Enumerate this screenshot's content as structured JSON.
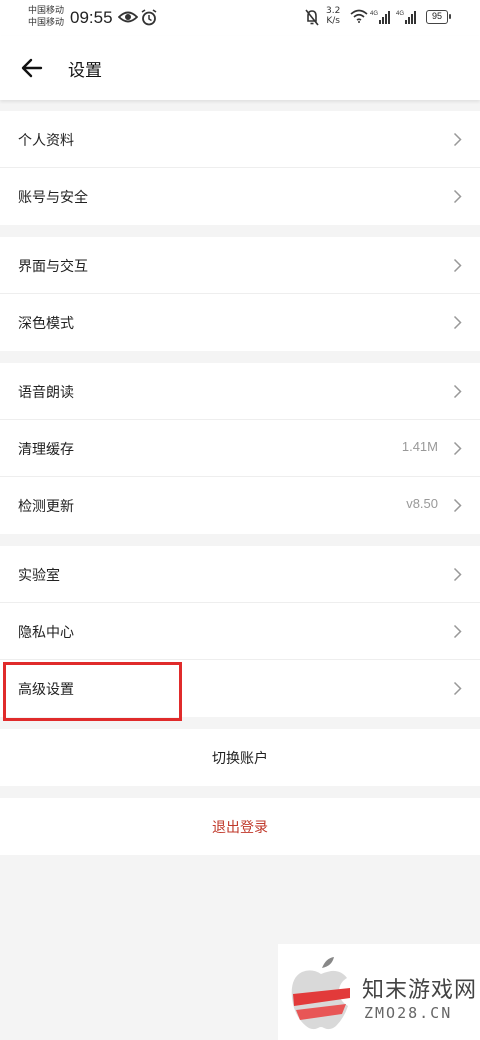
{
  "status_bar": {
    "carrier_1": "中国移动",
    "carrier_2": "中国移动",
    "time": "09:55",
    "speed_value": "3.2",
    "speed_unit": "K/s",
    "battery": "95"
  },
  "header": {
    "title": "设置"
  },
  "groups": [
    {
      "items": [
        {
          "label": "个人资料"
        },
        {
          "label": "账号与安全"
        }
      ]
    },
    {
      "items": [
        {
          "label": "界面与交互"
        },
        {
          "label": "深色模式"
        }
      ]
    },
    {
      "items": [
        {
          "label": "语音朗读"
        },
        {
          "label": "清理缓存",
          "value": "1.41M"
        },
        {
          "label": "检测更新",
          "value": "v8.50"
        }
      ]
    },
    {
      "items": [
        {
          "label": "实验室"
        },
        {
          "label": "隐私中心"
        },
        {
          "label": "高级设置"
        }
      ]
    }
  ],
  "actions": {
    "switch_account": "切换账户",
    "logout": "退出登录"
  },
  "colors": {
    "highlight": "#e02b2b",
    "logout": "#c0392b",
    "background": "#f4f4f4"
  },
  "watermark": {
    "name": "知末游戏网",
    "domain": "ZMO28.CN"
  }
}
